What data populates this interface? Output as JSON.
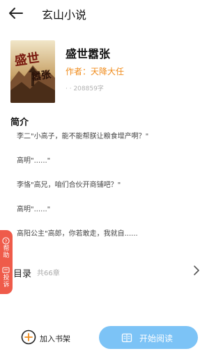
{
  "header": {
    "title": "玄山小说"
  },
  "book": {
    "cover_title": "盛世嚣张",
    "title": "盛世嚣张",
    "author": "作者：天降大任",
    "word_count": "· · 208859字"
  },
  "intro": {
    "heading": "简介",
    "lines": [
      "李二\"小高子，能不能帮朕让粮食增产啊？\"",
      "高明\"......\"",
      "李恪\"高兄，咱们合伙开商铺吧？\"",
      "高明\"......\"",
      "高阳公主\"高郎，你若敢走，我就自......"
    ]
  },
  "side_tab": {
    "help": "帮助",
    "complain": "投诉"
  },
  "toc": {
    "label": "目录",
    "count": "共66章"
  },
  "footer": {
    "shelf_label": "加入书架",
    "read_label": "开始阅读"
  },
  "colors": {
    "accent": "#f08c1c",
    "button": "#7cc3f6",
    "side_tab": "#ef5b4a"
  }
}
